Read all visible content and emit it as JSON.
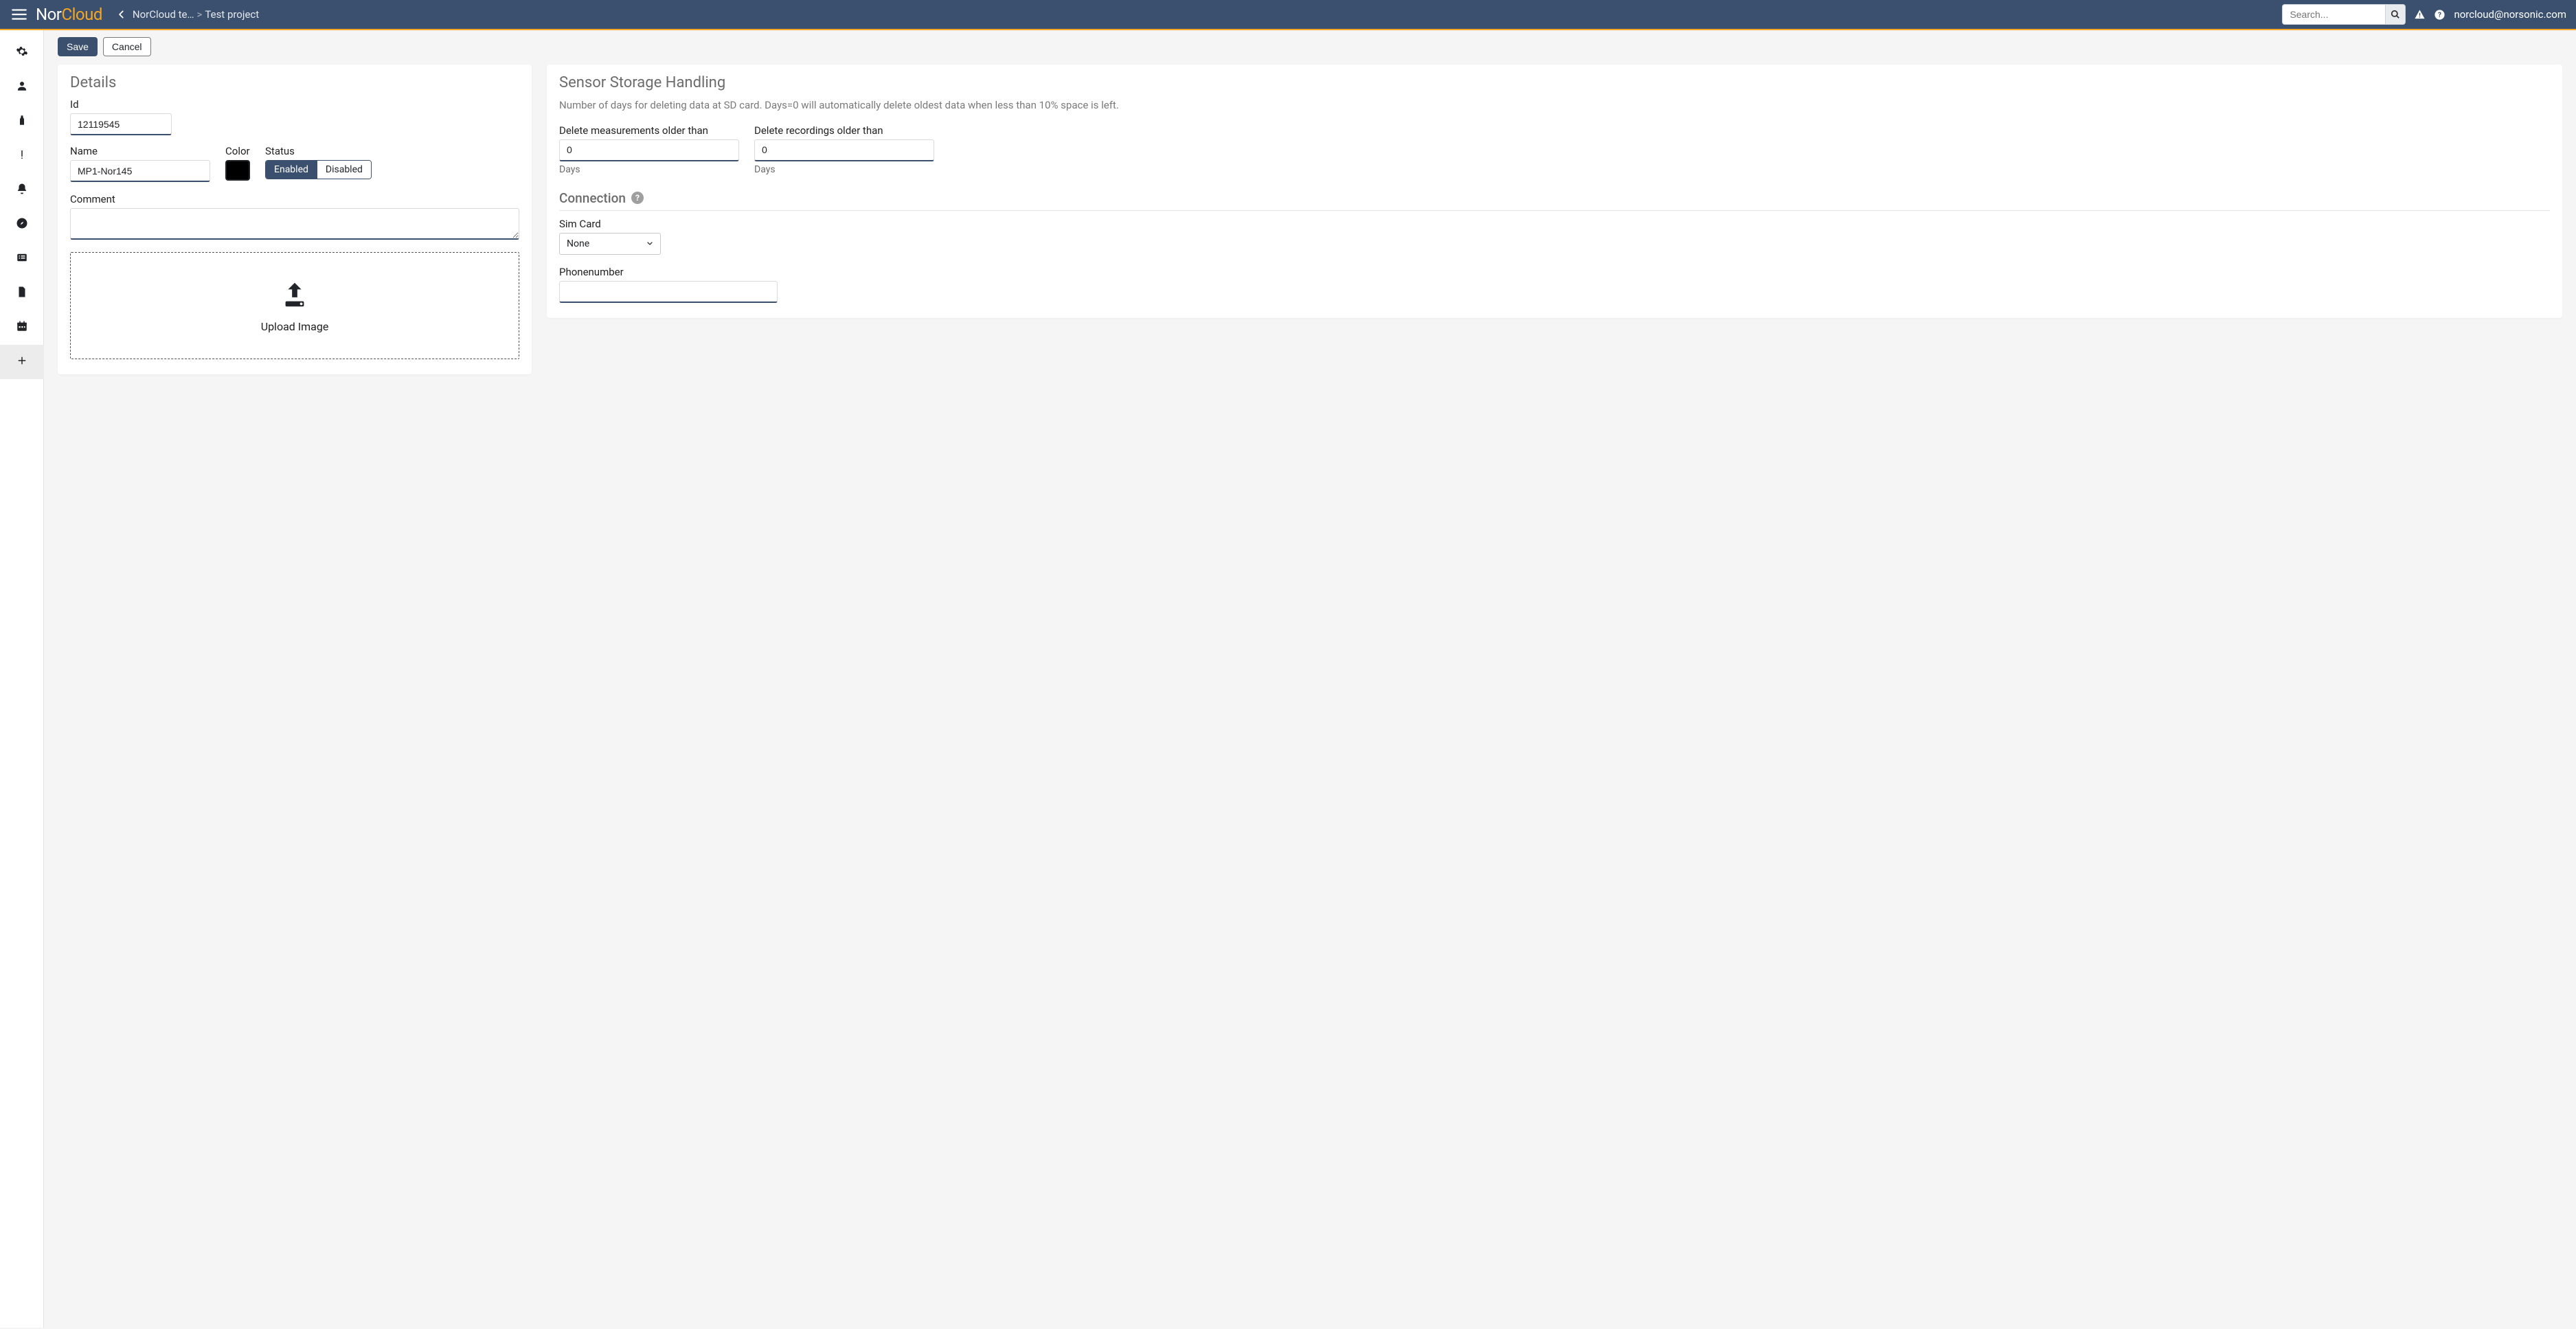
{
  "header": {
    "brand_nor": "Nor",
    "brand_cloud": "Cloud",
    "breadcrumb_1": "NorCloud te…",
    "breadcrumb_sep": ">",
    "breadcrumb_2": "Test project",
    "search_placeholder": "Search...",
    "user_email": "norcloud@norsonic.com"
  },
  "actions": {
    "save": "Save",
    "cancel": "Cancel"
  },
  "details": {
    "title": "Details",
    "id_label": "Id",
    "id_value": "12119545",
    "name_label": "Name",
    "name_value": "MP1-Nor145",
    "color_label": "Color",
    "color_value": "#000000",
    "status_label": "Status",
    "status_enabled": "Enabled",
    "status_disabled": "Disabled",
    "comment_label": "Comment",
    "comment_value": "",
    "upload_label": "Upload Image"
  },
  "storage": {
    "title": "Sensor Storage Handling",
    "description": "Number of days for deleting data at SD card. Days=0 will automatically delete oldest data when less than 10% space is left.",
    "delete_meas_label": "Delete measurements older than",
    "delete_meas_value": "0",
    "delete_rec_label": "Delete recordings older than",
    "delete_rec_value": "0",
    "days_label": "Days",
    "connection_title": "Connection",
    "sim_label": "Sim Card",
    "sim_value": "None",
    "phone_label": "Phonenumber",
    "phone_value": ""
  }
}
